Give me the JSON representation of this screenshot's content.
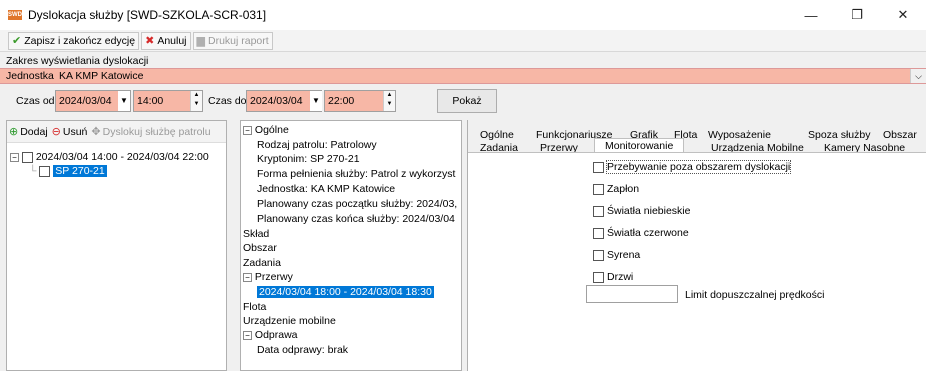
{
  "window": {
    "title": "Dyslokacja służby [SWD-SZKOLA-SCR-031]",
    "app_icon_text": "SWD",
    "minimize": "—",
    "maximize": "❐",
    "close": "✕"
  },
  "toolbar": {
    "save_label": "Zapisz i zakończ edycję",
    "cancel_label": "Anuluj",
    "print_label": "Drukuj raport"
  },
  "zakres": {
    "label": "Zakres wyświetlania dyslokacji",
    "jednostka_label": "Jednostka",
    "jednostka_value": "KA KMP Katowice"
  },
  "czas": {
    "od_label": "Czas od",
    "od_date": "2024/03/04",
    "od_time": "14:00",
    "do_label": "Czas do",
    "do_date": "2024/03/04",
    "do_time": "22:00",
    "pokaz_label": "Pokaż"
  },
  "left_panel": {
    "add_label": "Dodaj",
    "remove_label": "Usuń",
    "dyslokuj_label": "Dyslokuj służbę patrolu",
    "tree": [
      {
        "label": "2024/03/04 14:00 - 2024/03/04 22:00"
      },
      {
        "label": "SP 270-21"
      }
    ]
  },
  "mid_panel": {
    "tree": [
      "Ogólne",
      "Rodzaj patrolu: Patrolowy",
      "Kryptonim: SP 270-21",
      "Forma pełnienia służby: Patrol z wykorzyst",
      "Jednostka: KA KMP Katowice",
      "Planowany czas początku służby: 2024/03,",
      "Planowany czas końca służby: 2024/03/04",
      "Skład",
      "Obszar",
      "Zadania",
      "Przerwy",
      "2024/03/04 18:00 - 2024/03/04 18:30",
      "Flota",
      "Urządzenie mobilne",
      "Odprawa",
      "Data odprawy: brak"
    ]
  },
  "tabs": {
    "row1": [
      "Ogólne",
      "Funkcjonariusze",
      "Grafik",
      "Flota",
      "Wyposażenie",
      "Spoza służby",
      "Obszar"
    ],
    "row2": [
      "Zadania",
      "Przerwy",
      "Monitorowanie",
      "Urządzenia Mobilne",
      "Kamery Nasobne"
    ]
  },
  "monitorowanie": {
    "checkboxes": [
      "Przebywanie poza obszarem dyslokacji",
      "Zapłon",
      "Światła niebieskie",
      "Światła czerwone",
      "Syrena",
      "Drzwi"
    ],
    "limit_label": "Limit dopuszczalnej prędkości"
  }
}
